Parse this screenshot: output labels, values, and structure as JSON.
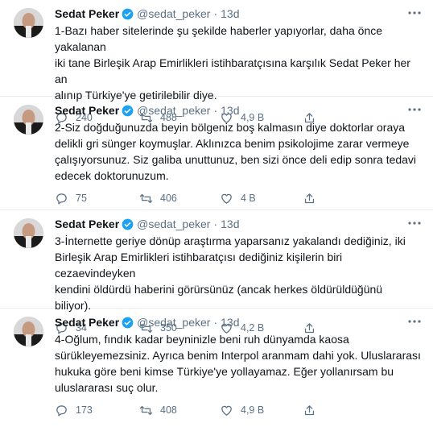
{
  "tweets": [
    {
      "name": "Sedat Peker",
      "handle": "@sedat_peker",
      "separator": "·",
      "time": "13d",
      "text": "1-Bazı haber sitelerinde şu şekilde haberler yapıyorlar, daha önce yakalanan\niki tane Birleşik Arap Emirlikleri istihbaratçısına karşılık Sedat Peker her an\nalınıp Türkiye'ye getirilebilir diye.",
      "replies": "240",
      "retweets": "488",
      "likes": "4,9 B"
    },
    {
      "name": "Sedat Peker",
      "handle": "@sedat_peker",
      "separator": "·",
      "time": "13d",
      "text": "2-Siz doğduğunuzda beyin bölgeniz boş kalmasın diye doktorlar oraya\ndelikli gri sünger koymuşlar. Aklınızca benim psikolojime zarar vermeye\nçalışıyorsunuz. Siz galiba unuttunuz, ben sizi önce deli edip sonra tedavi\nedecek doktorunuzum.",
      "replies": "75",
      "retweets": "406",
      "likes": "4 B"
    },
    {
      "name": "Sedat Peker",
      "handle": "@sedat_peker",
      "separator": "·",
      "time": "13d",
      "text": "3-İnternette geriye dönüp araştırma yaparsanız yakalandı dediğiniz, iki\nBirleşik Arap Emirlikleri istihbaratçısı dediğiniz kişilerin biri cezaevindeyken\nkendini öldürdü haberini görürsünüz (ancak herkes öldürüldüğünü biliyor).",
      "replies": "34",
      "retweets": "350",
      "likes": "4,2 B"
    },
    {
      "name": "Sedat Peker",
      "handle": "@sedat_peker",
      "separator": "·",
      "time": "13d",
      "text": "4-Oğlum, fındık kadar beyninizle beni ruh dünyamda kaosa\nsürükleyemezsiniz. Ayrıca benim Interpol aranmam dahi yok. Uluslararası\nhukuka göre beni kimse Türkiye'ye yollayamaz. Eğer yollanırsam bu\nuluslararası suç olur.",
      "replies": "173",
      "retweets": "408",
      "likes": "4,9 B"
    }
  ],
  "icons": {
    "verified": "verified-badge-icon",
    "more": "more-options-icon",
    "reply": "reply-icon",
    "retweet": "retweet-icon",
    "like": "like-icon",
    "share": "share-icon"
  },
  "colors": {
    "verified": "#1da1f2",
    "secondary_text": "#5b7083",
    "divider": "#e6ecf0"
  }
}
